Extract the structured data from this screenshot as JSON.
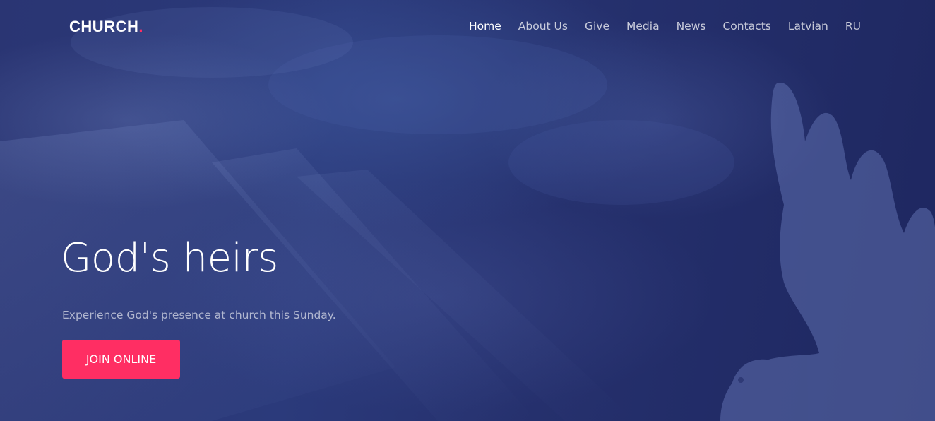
{
  "brand": {
    "name": "CHURCH",
    "dot": ".",
    "dot_color": "#ff2e63"
  },
  "nav": {
    "items": [
      {
        "label": "Home",
        "active": true
      },
      {
        "label": "About Us",
        "active": false
      },
      {
        "label": "Give",
        "active": false
      },
      {
        "label": "Media",
        "active": false
      },
      {
        "label": "News",
        "active": false
      },
      {
        "label": "Contacts",
        "active": false
      },
      {
        "label": "Latvian",
        "active": false
      },
      {
        "label": "RU",
        "active": false
      }
    ]
  },
  "hero": {
    "title": "God's heirs",
    "subtitle": "Experience God's presence at church this Sunday.",
    "cta_label": "JOIN ONLINE"
  },
  "colors": {
    "accent": "#ff2e63",
    "background": "#27316f",
    "text": "#ffffff"
  }
}
